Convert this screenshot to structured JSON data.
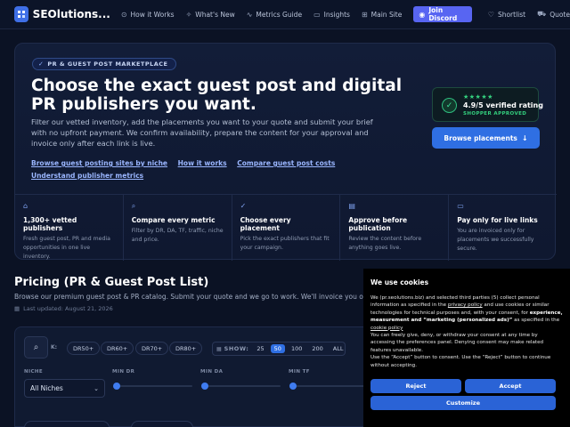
{
  "nav": {
    "brand": "SEOlutions...",
    "items": [
      {
        "label": "How it Works",
        "icon": "⊙"
      },
      {
        "label": "What's New",
        "icon": "✧"
      },
      {
        "label": "Metrics Guide",
        "icon": "∿"
      },
      {
        "label": "Insights",
        "icon": "▭"
      },
      {
        "label": "Main Site",
        "icon": "⊞"
      }
    ],
    "discord_label": "Join Discord",
    "shortlist_label": "Shortlist",
    "quote_label": "Quote"
  },
  "hero": {
    "badge": "PR & GUEST POST MARKETPLACE",
    "title": "Choose the exact guest post and digital PR publishers you want.",
    "description": "Filter our vetted inventory, add the placements you want to your quote and submit your brief with no upfront payment. We confirm availability, prepare the content for your approval and invoice only after each link is live.",
    "links": [
      "Browse guest posting sites by niche",
      "How it works",
      "Compare guest post costs",
      "Understand publisher metrics"
    ],
    "rating": {
      "stars": "★★★★★",
      "text": "4.9/5 verified rating",
      "sub": "SHOPPER APPROVED"
    },
    "browse_button": "Browse placements",
    "features": [
      {
        "icon": "⌂",
        "title": "1,300+ vetted publishers",
        "desc": "Fresh guest post, PR and media opportunities in one live inventory."
      },
      {
        "icon": "⌕",
        "title": "Compare every metric",
        "desc": "Filter by DR, DA, TF, traffic, niche and price."
      },
      {
        "icon": "✓",
        "title": "Choose every placement",
        "desc": "Pick the exact publishers that fit your campaign."
      },
      {
        "icon": "▤",
        "title": "Approve before publication",
        "desc": "Review the content before anything goes live."
      },
      {
        "icon": "▭",
        "title": "Pay only for live links",
        "desc": "You are invoiced only for placements we successfully secure."
      }
    ]
  },
  "pricing": {
    "title": "Pricing (PR & Guest Post List)",
    "description": "Browse our premium guest post & PR catalog. Submit your quote and we go to work. We'll invoice you only for li",
    "updated": "Last updated: August 21, 2026"
  },
  "filters": {
    "quick_label": "K:",
    "chips": [
      "DR50+",
      "DR60+",
      "DR70+",
      "DR80+"
    ],
    "show_label": "SHOW:",
    "show_options": [
      "25",
      "50",
      "100",
      "200",
      "ALL"
    ],
    "show_active": "50",
    "niche_label": "NICHE",
    "niche_value": "All Niches",
    "min_dr_label": "MIN DR",
    "min_da_label": "MIN DA",
    "min_tf_label": "MIN TF"
  },
  "cookie": {
    "title": "We use cookies",
    "p1_a": "We (pr.seolutions.biz) and selected third parties (5) collect personal information as specified in the ",
    "privacy_link": "privacy policy",
    "p1_b": " and use cookies or similar technologies for technical purposes and, with your consent, for ",
    "p1_bold": "experience, measurement and “marketing (personalized ads)”",
    "p1_c": " as specified in the ",
    "cookie_link": "cookie policy",
    "p2": "You can freely give, deny, or withdraw your consent at any time by accessing the preferences panel. Denying consent may make related features unavailable.",
    "p3": "Use the “Accept” button to consent. Use the “Reject” button to continue without accepting.",
    "reject": "Reject",
    "accept": "Accept",
    "customize": "Customize"
  },
  "colors": {
    "accent": "#2f6fe3",
    "discord": "#5865f2",
    "success": "#34d27f",
    "background": "#0b1224"
  }
}
